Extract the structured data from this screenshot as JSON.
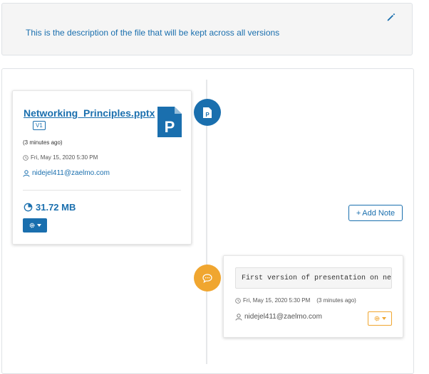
{
  "description": {
    "text": "This is the description of the file that will be kept across all versions",
    "edit_icon": "pencil-icon"
  },
  "file_version": {
    "file_name": "Networking_Principles.pptx",
    "version": "V1",
    "relative_time": "(3 minutes ago)",
    "date": "Fri, May 15, 2020 5:30 PM",
    "user": "nidejel411@zaelmo.com",
    "size": "31.72 MB",
    "file_icon": "powerpoint-file-icon",
    "size_icon": "pie-chart-icon",
    "settings_icon": "gear-icon"
  },
  "add_note_button": {
    "plus": "+",
    "label": "Add Note"
  },
  "note": {
    "text": "First version of presentation on networking principles",
    "date": "Fri, May 15, 2020 5:30 PM",
    "relative_time": "(3 minutes ago)",
    "user": "nidejel411@zaelmo.com",
    "marker_icon": "comment-icon",
    "settings_icon": "gear-icon"
  },
  "colors": {
    "accent_blue": "#1a6fae",
    "accent_orange": "#f0a630",
    "panel_bg": "#f5f5f5",
    "border": "#dfe2e6"
  }
}
